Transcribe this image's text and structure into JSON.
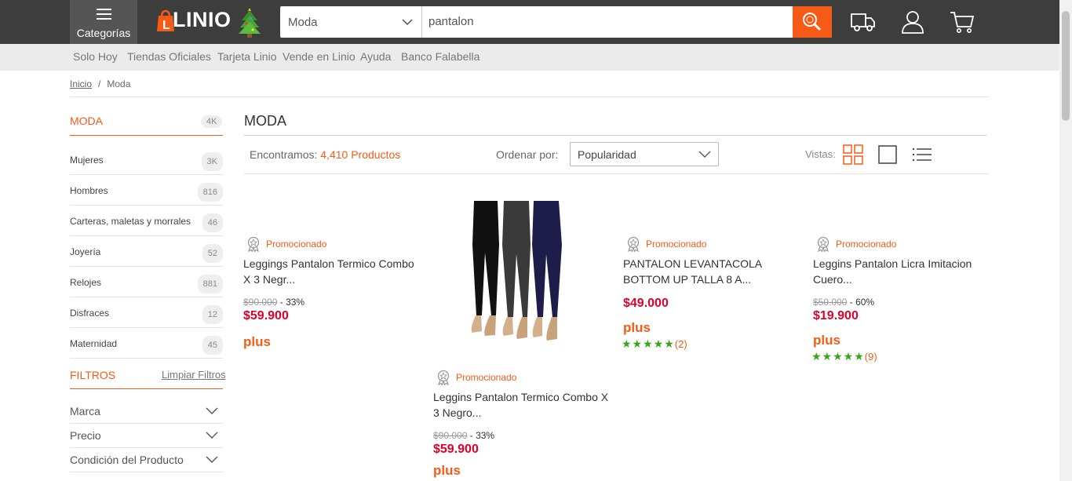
{
  "header": {
    "categories_label": "Categorías",
    "logo_text": "LINIO",
    "search": {
      "department": "Moda",
      "query": "pantalon"
    },
    "colors": {
      "topbar": "#3d3d3d",
      "accent": "#f55a16"
    }
  },
  "subnav": [
    "Solo Hoy",
    "Tiendas Oficiales",
    "Tarjeta Linio",
    "Vende en Linio",
    "Ayuda",
    "Banco Falabella"
  ],
  "breadcrumb": {
    "home": "Inicio",
    "sep": "/",
    "current": "Moda"
  },
  "sidebar": {
    "title": "MODA",
    "title_count": "4K",
    "items": [
      {
        "label": "Mujeres",
        "count": "3K"
      },
      {
        "label": "Hombres",
        "count": "816"
      },
      {
        "label": "Carteras, maletas y morrales",
        "count": "46"
      },
      {
        "label": "Joyería",
        "count": "52"
      },
      {
        "label": "Relojes",
        "count": "881"
      },
      {
        "label": "Disfraces",
        "count": "12"
      },
      {
        "label": "Maternidad",
        "count": "45"
      }
    ],
    "filters_title": "FILTROS",
    "clear_filters": "Limpiar Filtros",
    "filters": [
      "Marca",
      "Precio",
      "Condición del Producto"
    ]
  },
  "main": {
    "title": "MODA",
    "found_prefix": "Encontramos: ",
    "found_count": "4,410 Productos",
    "order_label": "Ordenar por:",
    "order_value": "Popularidad",
    "views_label": "Vistas:"
  },
  "products": [
    {
      "promo": "Promocionado",
      "name": "Leggings Pantalon Termico Combo X 3 Negr...",
      "old_price": "$90.000",
      "discount": "- 33%",
      "price": "$59.900",
      "plus": "plus"
    },
    {
      "promo": "Promocionado",
      "name": "Leggins Pantalon Termico Combo X 3 Negro...",
      "old_price": "$90.000",
      "discount": "- 33%",
      "price": "$59.900",
      "plus": "plus"
    },
    {
      "promo": "Promocionado",
      "name": "PANTALON LEVANTACOLA BOTTOM UP TALLA 8 A...",
      "price": "$49.000",
      "plus": "plus",
      "stars": "★★★★★",
      "rating": "(2)"
    },
    {
      "promo": "Promocionado",
      "name": "Leggins Pantalon Licra Imitacion Cuero...",
      "old_price": "$50.000",
      "discount": "- 60%",
      "price": "$19.900",
      "plus": "plus",
      "stars": "★★★★★",
      "rating": "(9)"
    }
  ]
}
